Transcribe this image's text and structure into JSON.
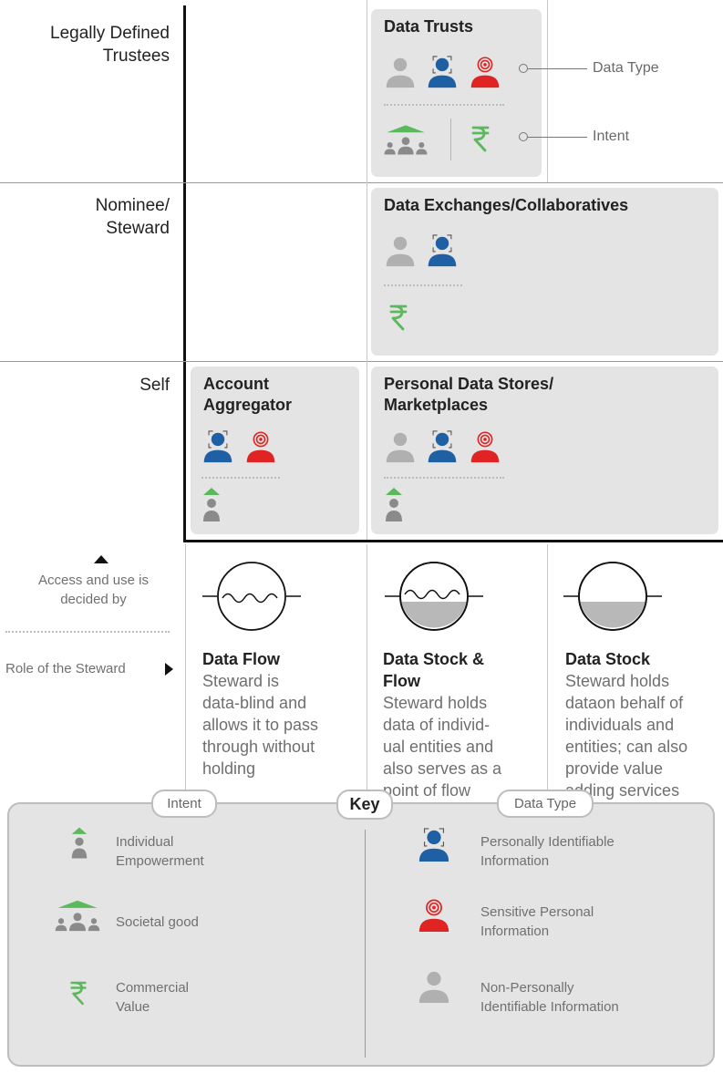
{
  "rows": {
    "legal": "Legally Defined\nTrustees",
    "nominee": "Nominee/\nSteward",
    "self": "Self"
  },
  "cards": {
    "data_trusts": "Data Trusts",
    "exchanges": "Data Exchanges/Collaboratives",
    "account_aggregator": "Account\nAggregator",
    "personal_stores": "Personal Data Stores/\nMarketplaces"
  },
  "annotations": {
    "data_type": "Data Type",
    "intent": "Intent"
  },
  "left_legend": {
    "access": "Access and use is\ndecided by",
    "role": "Role of the Steward"
  },
  "columns": [
    {
      "title": "Data Flow",
      "text": "Steward is\ndata-blind and\nallows it to pass\nthrough without\nholding"
    },
    {
      "title": "Data Stock &\nFlow",
      "text": "Steward holds\ndata of individ-\nual entities and\nalso serves as a\npoint of flow"
    },
    {
      "title": "Data Stock",
      "text": "Steward holds\ndataon behalf of\nindividuals and\nentities; can also\nprovide value\nadding services\nsuch as analysis"
    }
  ],
  "key": {
    "title": "Key",
    "intent_tab": "Intent",
    "datatype_tab": "Data Type",
    "intent_items": [
      "Individual\nEmpowerment",
      "Societal good",
      "Commercial\nValue"
    ],
    "datatype_items": [
      "Personally Identifiable\nInformation",
      "Sensitive Personal\nInformation",
      "Non-Personally\nIdentifiable Information"
    ]
  },
  "rupee": "₹",
  "colors": {
    "blue": "#1f5fa3",
    "red": "#e02424",
    "gray_icon": "#b0b0b0",
    "green": "#5cb85c",
    "card_bg": "#e4e4e4"
  },
  "icons": {
    "pii": "pii-person-icon",
    "spi": "sensitive-target-icon",
    "npii": "non-pii-person-icon",
    "individual": "individual-empowerment-icon",
    "societal": "societal-good-icon",
    "commercial": "rupee-icon"
  }
}
